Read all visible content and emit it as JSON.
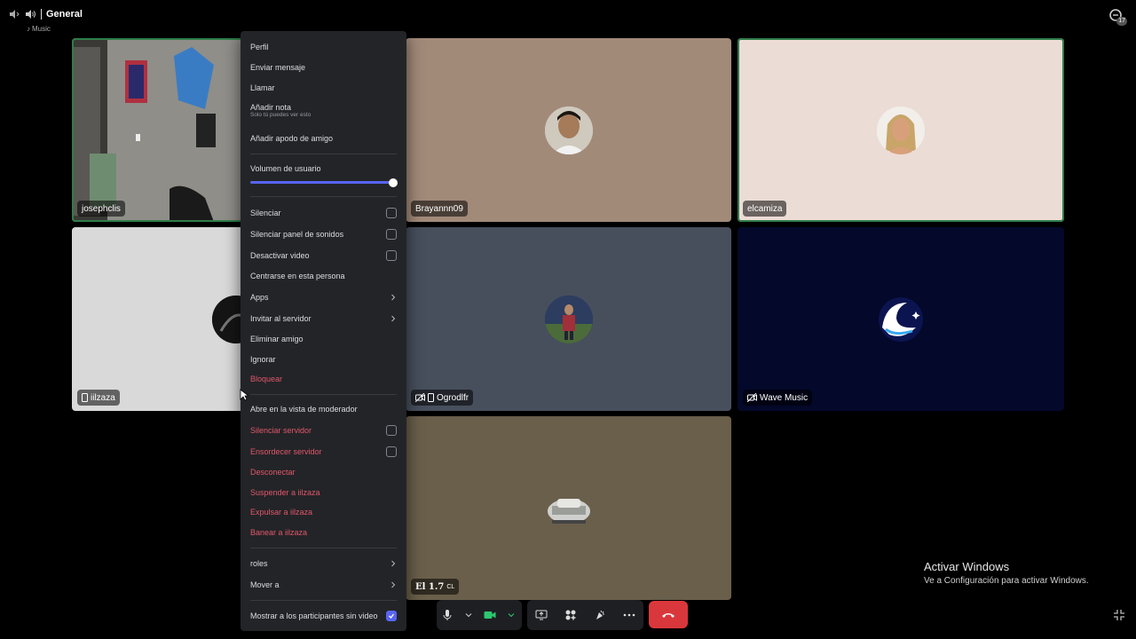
{
  "header": {
    "channel": "General",
    "activity": "Music",
    "inbox_count": "17"
  },
  "tiles": {
    "t1": {
      "name": "josephclis"
    },
    "t2": {
      "name": "Brayannn09"
    },
    "t3": {
      "name": "elcamiza"
    },
    "t4": {
      "name": "iilzaza"
    },
    "t5": {
      "name": "Ogrodlfr"
    },
    "t6": {
      "name": "Wave Music"
    },
    "t7": {
      "name": "El 1.7",
      "suffix": "CL"
    }
  },
  "menu": {
    "profile": "Perfil",
    "message": "Enviar mensaje",
    "call": "Llamar",
    "add_note": "Añadir nota",
    "add_note_hint": "Solo tú puedes ver esto",
    "friend_nickname": "Añadir apodo de amigo",
    "user_volume": "Volumen de usuario",
    "user_volume_value": 1.0,
    "mute": "Silenciar",
    "mute_soundboard": "Silenciar panel de sonidos",
    "disable_video": "Desactivar video",
    "focus": "Centrarse en esta persona",
    "apps": "Apps",
    "invite": "Invitar al servidor",
    "remove_friend": "Eliminar amigo",
    "ignore": "Ignorar",
    "block": "Bloquear",
    "mod_view": "Abre en la vista de moderador",
    "server_mute": "Silenciar servidor",
    "server_deafen": "Ensordecer servidor",
    "disconnect": "Desconectar",
    "suspend": "Suspender a iilzaza",
    "kick": "Expulsar a iilzaza",
    "ban": "Banear a iilzaza",
    "roles": "roles",
    "move_to": "Mover a",
    "show_no_video": "Mostrar a los participantes sin video"
  },
  "watermark": {
    "title": "Activar Windows",
    "subtitle": "Ve a Configuración para activar Windows."
  },
  "colors": {
    "accent": "#5865f2",
    "danger": "#e0576a",
    "hangup": "#da373c",
    "speaking": "#2f7d4a"
  }
}
